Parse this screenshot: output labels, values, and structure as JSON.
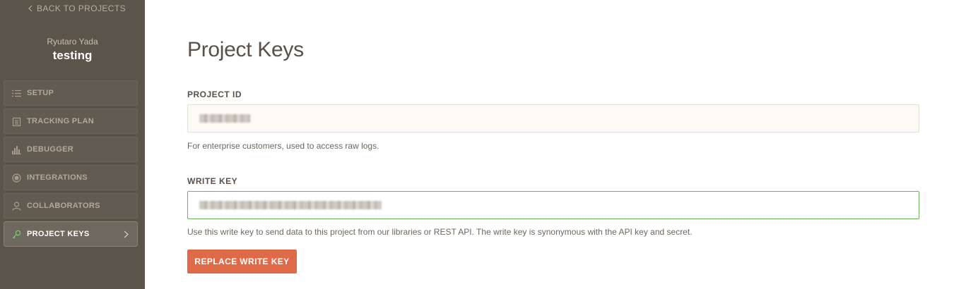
{
  "sidebar": {
    "back_label": "BACK TO PROJECTS",
    "user_name": "Ryutaro Yada",
    "workspace_name": "testing",
    "items": [
      {
        "label": "SETUP",
        "icon": "list-icon",
        "active": false
      },
      {
        "label": "TRACKING PLAN",
        "icon": "clipboard-icon",
        "active": false
      },
      {
        "label": "DEBUGGER",
        "icon": "bar-chart-icon",
        "active": false
      },
      {
        "label": "INTEGRATIONS",
        "icon": "circle-icon",
        "active": false
      },
      {
        "label": "COLLABORATORS",
        "icon": "user-icon",
        "active": false
      },
      {
        "label": "PROJECT KEYS",
        "icon": "key-icon",
        "active": true
      }
    ]
  },
  "main": {
    "title": "Project Keys",
    "project_id": {
      "label": "PROJECT ID",
      "help": "For enterprise customers, used to access raw logs."
    },
    "write_key": {
      "label": "WRITE KEY",
      "help": "Use this write key to send data to this project from our libraries or REST API. The write key is synonymous with the API key and secret."
    },
    "replace_button_label": "REPLACE WRITE KEY"
  },
  "colors": {
    "sidebar_bg": "#5b544b",
    "accent_button": "#df6a47",
    "focus_border": "#67b457",
    "active_icon": "#7cc26b"
  }
}
